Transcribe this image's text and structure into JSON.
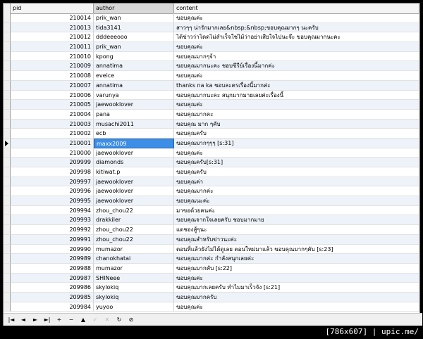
{
  "columns": {
    "pid": "pid",
    "author": "author",
    "content": "content"
  },
  "rows": [
    {
      "pid": "210014",
      "author": "prik_wan",
      "content": "ขอบคุณค่ะ"
    },
    {
      "pid": "210013",
      "author": "tida3141",
      "content": "สาวๆๆ น่ารักมากเลย&nbsp;&nbsp;ขอบคุณมากๆ นะครับ"
    },
    {
      "pid": "210012",
      "author": "dddeeeooo",
      "content": "ได้ข่าวว่าโดดไม่สำเร็จใช่ไม้ว่าอย่าเสียใจไปนะจ๊ะ ขอบคุณมากนะคะ"
    },
    {
      "pid": "210011",
      "author": "prik_wan",
      "content": "ขอบคุณค่ะ"
    },
    {
      "pid": "210010",
      "author": "kpong",
      "content": "ขอบคุณมากๆจ้า"
    },
    {
      "pid": "210009",
      "author": "annatima",
      "content": "ขอบคุณมากนะคะ ชอบซีรีย์เรื่องนี้มากค่ะ"
    },
    {
      "pid": "210008",
      "author": "eveice",
      "content": "ขอบคุณค่ะ"
    },
    {
      "pid": "210007",
      "author": "annatima",
      "content": "thanks na ka ชอบละครเรื่องนี้มากค่ะ"
    },
    {
      "pid": "210006",
      "author": "varunya",
      "content": "ขอบคุณมากนะคะ สนุกมากมายเลยค่ะเรื่องนี้"
    },
    {
      "pid": "210005",
      "author": "jaewooklover",
      "content": "ขอบคุณค่ะ"
    },
    {
      "pid": "210004",
      "author": "pana",
      "content": "ขอบคุณมากคะ"
    },
    {
      "pid": "210003",
      "author": "musachi2011",
      "content": "ขอบคุณ มาก ๆคับ"
    },
    {
      "pid": "210002",
      "author": "ecb",
      "content": "ขอบคุณครับ"
    },
    {
      "pid": "210001",
      "author": "maxx2009",
      "content": "ขอบคุณมากๆๆๆ [s:31]"
    },
    {
      "pid": "210000",
      "author": "jaewooklover",
      "content": "ขอบคุณค่ะ"
    },
    {
      "pid": "209999",
      "author": "diamonds",
      "content": "ขอบคุณครับ[s:31]"
    },
    {
      "pid": "209998",
      "author": "kitiwat.p",
      "content": "ขอบคุณครับ"
    },
    {
      "pid": "209997",
      "author": "jaewooklover",
      "content": "ขอบคุณค่า"
    },
    {
      "pid": "209996",
      "author": "jaewooklover",
      "content": "ขอบคุณมากค่ะ"
    },
    {
      "pid": "209995",
      "author": "jaewooklover",
      "content": "ขอบคุณนะค่ะ"
    },
    {
      "pid": "209994",
      "author": "zhou_chou22",
      "content": "มาขอด้วยคนค่ะ"
    },
    {
      "pid": "209993",
      "author": "drakkiler",
      "content": "ขอบคุณจากใจเลยครับ ชอบมากมาย"
    },
    {
      "pid": "209992",
      "author": "zhou_chou22",
      "content": "แดชองสู้ๆนะ"
    },
    {
      "pid": "209991",
      "author": "zhou_chou22",
      "content": "ขอบคุณสำหรับข่าวนะค่ะ"
    },
    {
      "pid": "209990",
      "author": "mumazor",
      "content": "ตอนที่แล้วยังไม่ได้ดูเลย ตอนใหม่มาแล้ว ขอบคุณมากๆคับ [s:23]"
    },
    {
      "pid": "209989",
      "author": "chanokhatai",
      "content": "ขอบคุณมากค่ะ กำลังสนุกเลยค่ะ"
    },
    {
      "pid": "209988",
      "author": "mumazor",
      "content": "ขอบคุณมากคับ [s:22]"
    },
    {
      "pid": "209987",
      "author": "SHINeee",
      "content": "ขอบคุณค่ะ"
    },
    {
      "pid": "209986",
      "author": "skylokiq",
      "content": "ขอบคุณมากเลยครับ ทำไมมาเร็วจัง [s:21]"
    },
    {
      "pid": "209985",
      "author": "skylokiq",
      "content": "ขอบคุณมากครับ"
    },
    {
      "pid": "209984",
      "author": "yuyoo",
      "content": "ขอบคุณค่ะ"
    }
  ],
  "current_row_index": 13,
  "navigator": [
    {
      "name": "first-record-button",
      "glyph": "|◄",
      "enabled": true
    },
    {
      "name": "prior-record-button",
      "glyph": "◄",
      "enabled": true
    },
    {
      "name": "next-record-button",
      "glyph": "►",
      "enabled": true
    },
    {
      "name": "last-record-button",
      "glyph": "►|",
      "enabled": true
    },
    {
      "name": "insert-record-button",
      "glyph": "+",
      "enabled": true
    },
    {
      "name": "delete-record-button",
      "glyph": "−",
      "enabled": true
    },
    {
      "name": "edit-record-button",
      "glyph": "▲",
      "enabled": true
    },
    {
      "name": "post-edit-button",
      "glyph": "✓",
      "enabled": false
    },
    {
      "name": "cancel-edit-button",
      "glyph": "✕",
      "enabled": false
    },
    {
      "name": "refresh-button",
      "glyph": "↻",
      "enabled": true
    },
    {
      "name": "apply-filter-button",
      "glyph": "⊘",
      "enabled": true
    }
  ],
  "caption": "[786x607] | upic.me/"
}
